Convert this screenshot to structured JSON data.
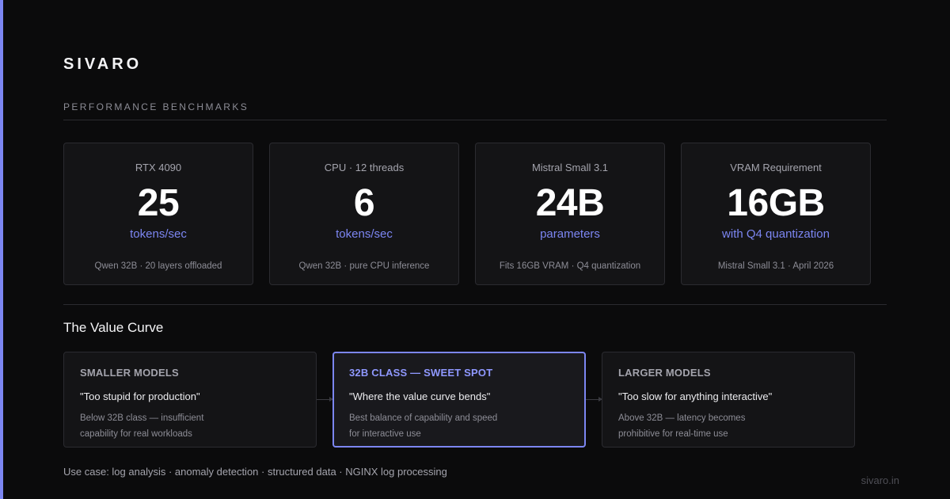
{
  "brand": "SIVARO",
  "section_label": "PERFORMANCE BENCHMARKS",
  "colors": {
    "accent": "#7c86f2",
    "background": "#0b0b0c",
    "card": "#141416"
  },
  "stats": [
    {
      "label": "RTX 4090",
      "value": "25",
      "unit": "tokens/sec",
      "note": "Qwen 32B · 20 layers offloaded"
    },
    {
      "label": "CPU · 12 threads",
      "value": "6",
      "unit": "tokens/sec",
      "note": "Qwen 32B · pure CPU inference"
    },
    {
      "label": "Mistral Small 3.1",
      "value": "24B",
      "unit": "parameters",
      "note": "Fits 16GB VRAM · Q4 quantization"
    },
    {
      "label": "VRAM Requirement",
      "value": "16GB",
      "unit": "with Q4 quantization",
      "note": "Mistral Small 3.1 · April 2026"
    }
  ],
  "value_curve": {
    "title": "The Value Curve",
    "tiers": [
      {
        "title": "SMALLER MODELS",
        "quote": "\"Too stupid for production\"",
        "desc": "Below 32B class — insufficient capability for real workloads"
      },
      {
        "title": "32B CLASS — SWEET SPOT",
        "quote": "\"Where the value curve bends\"",
        "desc": "Best balance of capability and speed for interactive use"
      },
      {
        "title": "LARGER MODELS",
        "quote": "\"Too slow for anything interactive\"",
        "desc": "Above 32B — latency becomes prohibitive for real-time use"
      }
    ]
  },
  "footer": {
    "use_case": "Use case: log analysis · anomaly detection · structured data · NGINX log processing",
    "site": "sivaro.in"
  }
}
